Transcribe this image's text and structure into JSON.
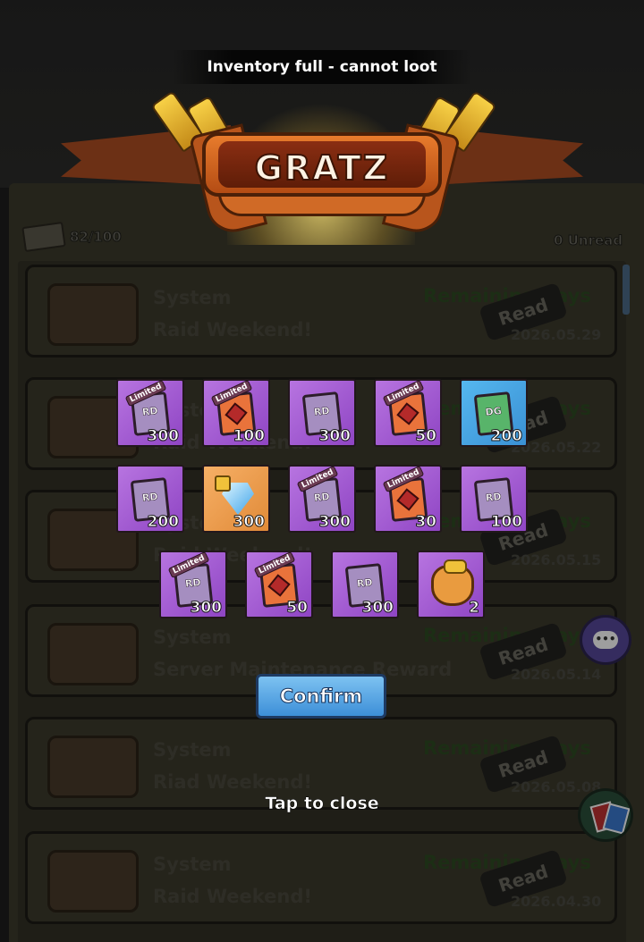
{
  "toast": "Inventory full - cannot loot",
  "banner": {
    "title": "GRATZ"
  },
  "mailbox": {
    "count": "82/100",
    "unread": "0 Unread",
    "mails": [
      {
        "sender": "System",
        "subject": "Raid Weekend!",
        "remaining": "Remaining days",
        "read": "Read",
        "date": "2026.05.29"
      },
      {
        "sender": "System",
        "subject": "Raid Weekend!",
        "remaining": "Remaining days",
        "read": "Read",
        "date": "2026.05.22"
      },
      {
        "sender": "System",
        "subject": "Raid Weekend!",
        "remaining": "Remaining days",
        "read": "Read",
        "date": "2026.05.15"
      },
      {
        "sender": "System",
        "subject": "Server Maintenance Reward",
        "remaining": "Remaining days",
        "read": "Read",
        "date": "2026.05.14"
      },
      {
        "sender": "System",
        "subject": "Riad Weekend!",
        "remaining": "Remaining days",
        "read": "Read",
        "date": "2026.05.08"
      },
      {
        "sender": "System",
        "subject": "Raid Weekend!",
        "remaining": "Remaining days",
        "read": "Read",
        "date": "2026.04.30"
      }
    ]
  },
  "rewards": [
    {
      "kind": "rd-ticket",
      "limited": true,
      "label": "RD",
      "qty": "300",
      "bg": "purple"
    },
    {
      "kind": "limited-ticket",
      "limited": true,
      "label": "",
      "qty": "100",
      "bg": "purple"
    },
    {
      "kind": "rd-ticket",
      "limited": false,
      "label": "RD",
      "qty": "300",
      "bg": "purple"
    },
    {
      "kind": "limited-ticket",
      "limited": true,
      "label": "",
      "qty": "50",
      "bg": "purple"
    },
    {
      "kind": "dg-ticket",
      "limited": false,
      "label": "DG",
      "qty": "200",
      "bg": "blue"
    },
    {
      "kind": "rd-ticket",
      "limited": false,
      "label": "RD",
      "qty": "200",
      "bg": "purple"
    },
    {
      "kind": "locked-diamond",
      "limited": false,
      "label": "",
      "qty": "300",
      "bg": "orange"
    },
    {
      "kind": "rd-ticket",
      "limited": true,
      "label": "RD",
      "qty": "300",
      "bg": "purple"
    },
    {
      "kind": "limited-ticket",
      "limited": true,
      "label": "",
      "qty": "30",
      "bg": "purple"
    },
    {
      "kind": "rd-ticket",
      "limited": false,
      "label": "RD",
      "qty": "100",
      "bg": "purple"
    },
    {
      "kind": "rd-ticket",
      "limited": true,
      "label": "RD",
      "qty": "300",
      "bg": "purple"
    },
    {
      "kind": "limited-ticket",
      "limited": true,
      "label": "",
      "qty": "50",
      "bg": "purple"
    },
    {
      "kind": "rd-ticket",
      "limited": false,
      "label": "RD",
      "qty": "300",
      "bg": "purple"
    },
    {
      "kind": "gold-pouch",
      "limited": false,
      "label": "",
      "qty": "2",
      "bg": "purple"
    }
  ],
  "limited_tag": "Limited",
  "confirm_label": "Confirm",
  "tap_to_close": "Tap to close",
  "icons": {
    "chat": "chat-icon",
    "gift": "cards-icon"
  },
  "colors": {
    "confirm": "#4a9fe4",
    "item_purple": "#a35ad2",
    "item_orange": "#f09b4c",
    "item_blue": "#4aa6e6",
    "banner": "#c95a1e"
  }
}
